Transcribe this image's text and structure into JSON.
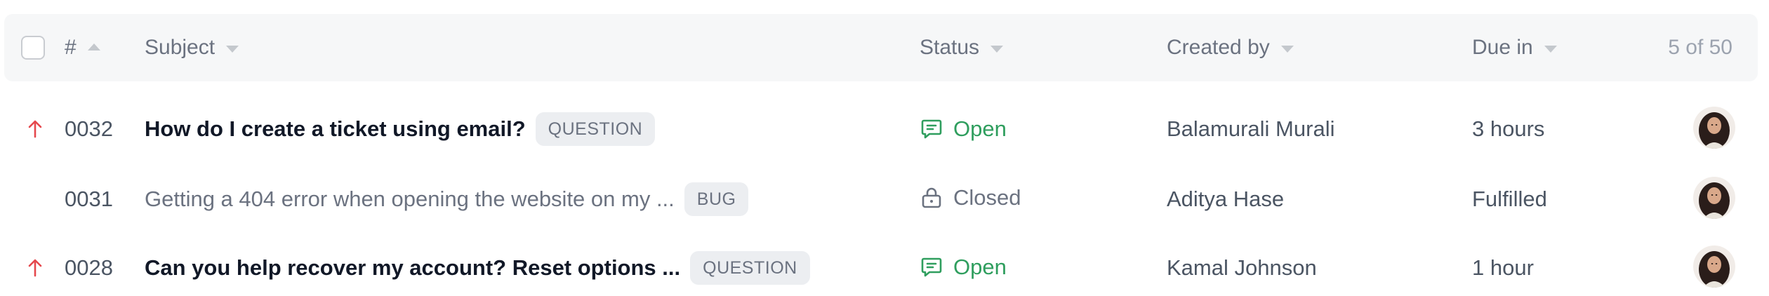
{
  "header": {
    "number_label": "#",
    "subject_label": "Subject",
    "status_label": "Status",
    "created_by_label": "Created by",
    "due_in_label": "Due in",
    "pagination": "5 of 50"
  },
  "rows": [
    {
      "priority_icon": "arrow-up-icon",
      "number": "0032",
      "subject": "How do I create a ticket using email?",
      "tag": "QUESTION",
      "status": "Open",
      "status_icon": "chat-icon",
      "created_by": "Balamurali Murali",
      "due_in": "3 hours"
    },
    {
      "priority_icon": "",
      "number": "0031",
      "subject": "Getting a 404 error when opening the website on my ...",
      "tag": "BUG",
      "status": "Closed",
      "status_icon": "lock-icon",
      "created_by": "Aditya Hase",
      "due_in": "Fulfilled"
    },
    {
      "priority_icon": "arrow-up-icon",
      "number": "0028",
      "subject": "Can you help recover my account? Reset options ...",
      "tag": "QUESTION",
      "status": "Open",
      "status_icon": "chat-icon",
      "created_by": "Kamal Johnson",
      "due_in": "1 hour"
    }
  ],
  "colors": {
    "open": "#2f9e5e",
    "priority_high": "#e5484d",
    "header_bg": "#f6f7f8",
    "badge_bg": "#eceef1"
  }
}
